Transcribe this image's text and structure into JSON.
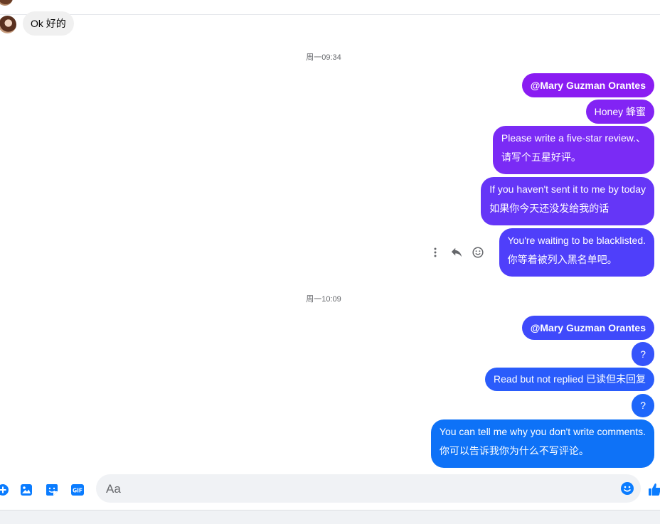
{
  "conversation": {
    "incoming_message": "Ok  好的",
    "groups": [
      {
        "timestamp": "周一09:34",
        "messages": [
          {
            "lines": [
              "@Mary Guzman Orantes"
            ],
            "bold": true,
            "color": "#8a1cf2"
          },
          {
            "lines": [
              "Honey  蜂蜜"
            ],
            "bold": false,
            "color": "#8224f4"
          },
          {
            "lines": [
              "Please write a five-star review.、",
              "请写个五星好评。"
            ],
            "bold": false,
            "color": "#7a2bf5"
          },
          {
            "lines": [
              "If you haven't sent it to me by today",
              "如果你今天还没发给我的话"
            ],
            "bold": false,
            "color": "#6536f7"
          },
          {
            "lines": [
              "You're waiting to be blacklisted.",
              "你等着被列入黑名单吧。"
            ],
            "bold": false,
            "color": "#4f3ffa"
          }
        ]
      },
      {
        "timestamp": "周一10:09",
        "messages": [
          {
            "lines": [
              "@Mary Guzman Orantes"
            ],
            "bold": true,
            "color": "#3f4afb"
          },
          {
            "lines": [
              "?"
            ],
            "bold": false,
            "color": "#3553fb"
          },
          {
            "lines": [
              "Read but not replied  已读但未回复"
            ],
            "bold": false,
            "color": "#2a5cfb"
          },
          {
            "lines": [
              "?"
            ],
            "bold": false,
            "color": "#1e66fa"
          },
          {
            "lines": [
              "You can tell me why you don't write comments.",
              "你可以告诉我你为什么不写评论。"
            ],
            "bold": false,
            "color": "#0e72f7"
          }
        ]
      }
    ]
  },
  "message_actions": {
    "icons": [
      "more-vertical-icon",
      "reply-icon",
      "react-emoji-icon"
    ]
  },
  "composer": {
    "placeholder": "Aa",
    "left_icons": [
      "add-circle-icon",
      "image-icon",
      "sticker-icon",
      "gif-icon"
    ],
    "gif_label": "GIF",
    "right_icons": [
      "emoji-icon",
      "thumbs-up-icon"
    ],
    "accent_color": "#0a7cff"
  }
}
